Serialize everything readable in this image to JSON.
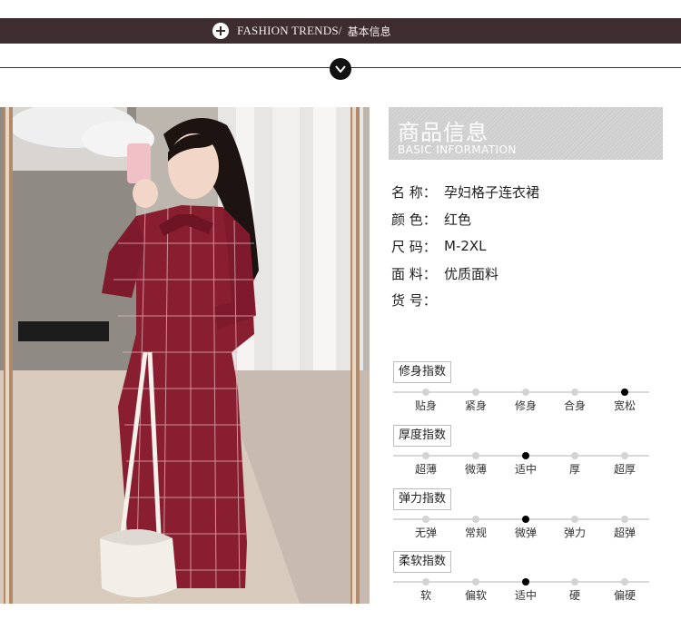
{
  "banner": {
    "title_en": "FASHION TRENDS/",
    "title_cn": "基本信息",
    "icon": "plus-circle-icon"
  },
  "divider": {
    "icon": "chevron-down-icon"
  },
  "info": {
    "title": "商品信息",
    "subtitle": "BASIC INFORMATION",
    "rows": [
      {
        "label": "名 称：",
        "value": "孕妇格子连衣裙"
      },
      {
        "label": "颜 色：",
        "value": "红色"
      },
      {
        "label": "尺 码：",
        "value": "M-2XL"
      },
      {
        "label": "面 料：",
        "value": "优质面料"
      },
      {
        "label": "货 号：",
        "value": ""
      }
    ]
  },
  "scales": [
    {
      "title": "修身指数",
      "options": [
        "贴身",
        "紧身",
        "修身",
        "合身",
        "宽松"
      ],
      "selected_index": 4
    },
    {
      "title": "厚度指数",
      "options": [
        "超薄",
        "微薄",
        "适中",
        "厚",
        "超厚"
      ],
      "selected_index": 2
    },
    {
      "title": "弹力指数",
      "options": [
        "无弹",
        "常规",
        "微弹",
        "弹力",
        "超弹"
      ],
      "selected_index": 2
    },
    {
      "title": "柔软指数",
      "options": [
        "软",
        "偏软",
        "适中",
        "硬",
        "偏硬"
      ],
      "selected_index": 2
    }
  ],
  "colors": {
    "banner": "#3d2d31",
    "dress": "#8a1e31",
    "header_bg": "#cfcfcf"
  }
}
